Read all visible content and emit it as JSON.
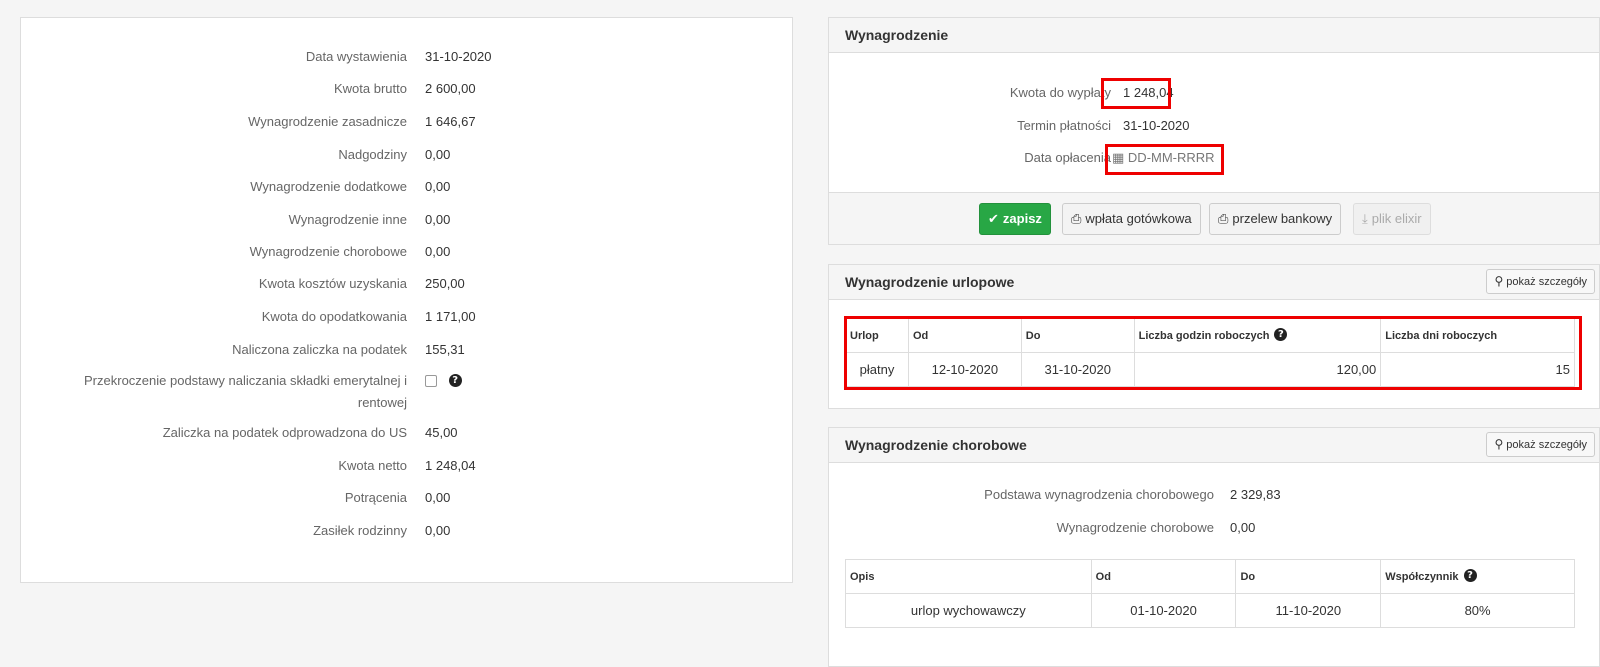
{
  "summary": {
    "rows": [
      {
        "label": "Data wystawienia",
        "value": "31-10-2020"
      },
      {
        "label": "Kwota brutto",
        "value": "2 600,00"
      },
      {
        "label": "Wynagrodzenie zasadnicze",
        "value": "1 646,67"
      },
      {
        "label": "Nadgodziny",
        "value": "0,00"
      },
      {
        "label": "Wynagrodzenie dodatkowe",
        "value": "0,00"
      },
      {
        "label": "Wynagrodzenie inne",
        "value": "0,00"
      },
      {
        "label": "Wynagrodzenie chorobowe",
        "value": "0,00"
      },
      {
        "label": "Kwota kosztów uzyskania",
        "value": "250,00"
      },
      {
        "label": "Kwota do opodatkowania",
        "value": "1 171,00"
      },
      {
        "label": "Naliczona zaliczka na podatek",
        "value": "155,31"
      },
      {
        "label": "Przekroczenie podstawy naliczania składki emerytalnej i",
        "label2": "rentowej"
      },
      {
        "label": "Zaliczka na podatek odprowadzona do US",
        "value": "45,00"
      },
      {
        "label": "Kwota netto",
        "value": "1 248,04"
      },
      {
        "label": "Potrącenia",
        "value": "0,00"
      },
      {
        "label": "Zasiłek rodzinny",
        "value": "0,00"
      }
    ],
    "help_glyph": "?"
  },
  "salary": {
    "title": "Wynagrodzenie",
    "amount_label": "Kwota do wypłaty",
    "amount_value": "1 248,04",
    "due_label": "Termin płatności",
    "due_value": "31-10-2020",
    "paid_label": "Data opłacenia",
    "paid_placeholder": "DD-MM-RRRR",
    "buttons": {
      "save": "zapisz",
      "cash": "wpłata gotówkowa",
      "transfer": "przelew bankowy",
      "elixir": "plik elixir"
    },
    "icons": {
      "save": "✔",
      "print": "⎙",
      "download": "⤓",
      "calendar": "▦"
    }
  },
  "vacation": {
    "title": "Wynagrodzenie urlopowe",
    "details_label": "pokaż szczegóły",
    "headers": [
      "Urlop",
      "Od",
      "Do",
      "Liczba godzin roboczych",
      "Liczba dni roboczych"
    ],
    "rows": [
      {
        "type": "płatny",
        "from": "12-10-2020",
        "to": "31-10-2020",
        "hours": "120,00",
        "days": "15"
      }
    ]
  },
  "sick": {
    "title": "Wynagrodzenie chorobowe",
    "details_label": "pokaż szczegóły",
    "base_label": "Podstawa wynagrodzenia chorobowego",
    "base_value": "2 329,83",
    "pay_label": "Wynagrodzenie chorobowe",
    "pay_value": "0,00",
    "headers": [
      "Opis",
      "Od",
      "Do",
      "Współczynnik"
    ],
    "rows": [
      {
        "desc": "urlop wychowawczy",
        "from": "01-10-2020",
        "to": "11-10-2020",
        "coef": "80%"
      }
    ]
  },
  "colors": {
    "highlight": "#e00000",
    "success": "#28a745"
  }
}
